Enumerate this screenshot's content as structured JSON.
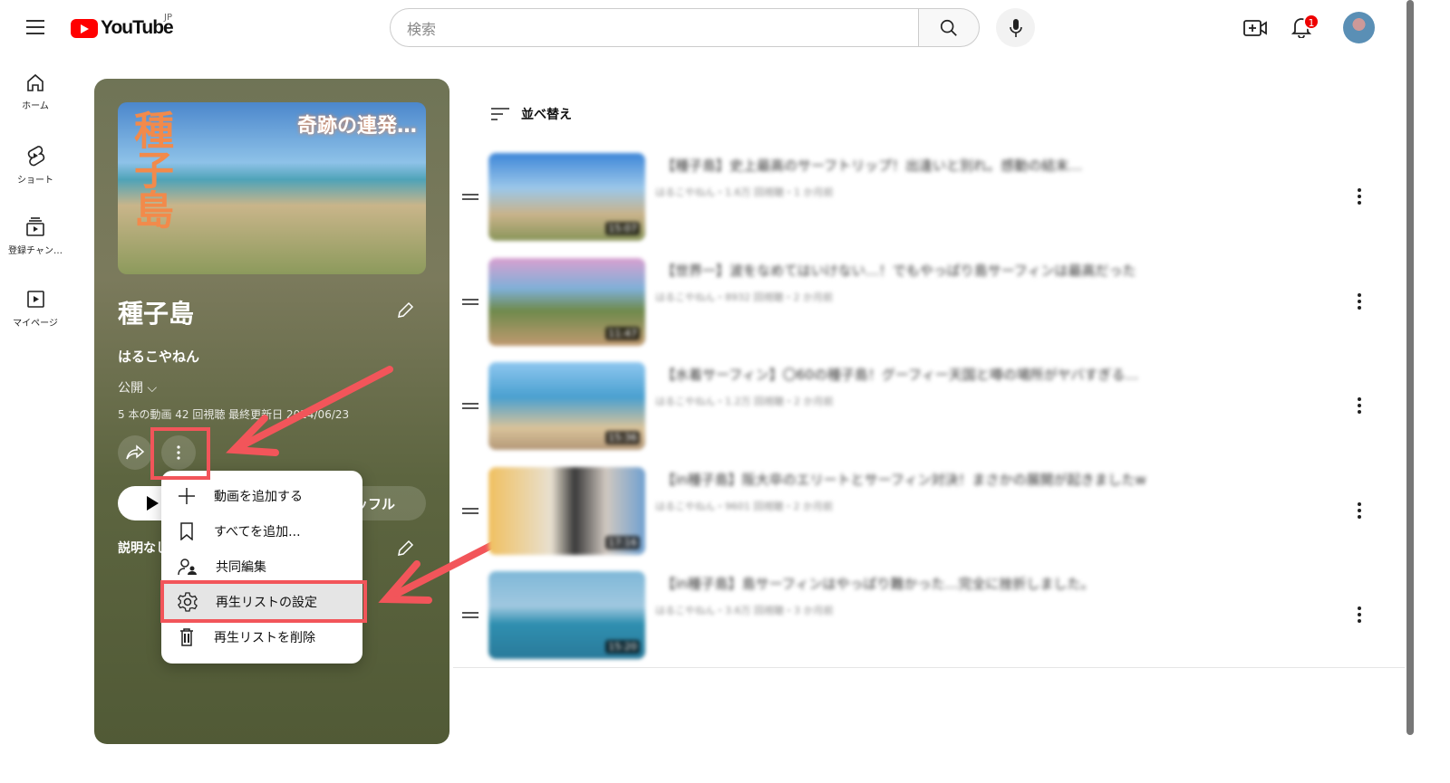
{
  "header": {
    "logo_text": "YouTube",
    "region": "JP",
    "search_placeholder": "検索",
    "notification_count": "1"
  },
  "sidebar": {
    "items": [
      {
        "label": "ホーム",
        "icon": "home-icon"
      },
      {
        "label": "ショート",
        "icon": "shorts-icon"
      },
      {
        "label": "登録チャン…",
        "icon": "subscriptions-icon"
      },
      {
        "label": "マイページ",
        "icon": "library-icon"
      }
    ]
  },
  "playlist": {
    "title": "種子島",
    "owner": "はるこやねん",
    "visibility": "公開",
    "stats": "5 本の動画  42 回視聴  最終更新日 2024/06/23",
    "thumb_text": "種子島",
    "thumb_subtitle": "奇跡の連発…",
    "shuffle_label": "シャッフル",
    "description": "説明なし"
  },
  "menu": {
    "items": [
      {
        "label": "動画を追加する",
        "icon": "plus-icon"
      },
      {
        "label": "すべてを追加...",
        "icon": "bookmark-icon"
      },
      {
        "label": "共同編集",
        "icon": "collaborate-icon"
      },
      {
        "label": "再生リストの設定",
        "icon": "gear-icon",
        "highlighted": true
      },
      {
        "label": "再生リストを削除",
        "icon": "trash-icon"
      }
    ]
  },
  "sort_label": "並べ替え",
  "videos": [
    {
      "title": "【種子島】史上最高のサーフトリップ！出逢いと別れ。感動の結末…",
      "meta": "はるこやねん・1.6万 回視聴・1 か月前",
      "duration": "15:07"
    },
    {
      "title": "【世界一】波をなめてはいけない…！でもやっぱり島サーフィンは最高だった",
      "meta": "はるこやねん・8932 回視聴・2 か月前",
      "duration": "11:47"
    },
    {
      "title": "【水着サーフィン】〇60の種子島！グーフィー天国と噂の場所がヤバすぎる…",
      "meta": "はるこやねん・1.2万 回視聴・2 か月前",
      "duration": "15:36"
    },
    {
      "title": "【in種子島】阪大卒のエリートとサーフィン対決！まさかの展開が起きましたw",
      "meta": "はるこやねん・9601 回視聴・2 か月前",
      "duration": "17:16"
    },
    {
      "title": "【in種子島】島サーフィンはやっぱり難かった…完全に挫折しました。",
      "meta": "はるこやねん・3.6万 回視聴・3 か月前",
      "duration": "15:20"
    }
  ],
  "colors": {
    "annotation": "#f2555a",
    "brand": "#ff0000",
    "panel": "#6a6f4e"
  }
}
